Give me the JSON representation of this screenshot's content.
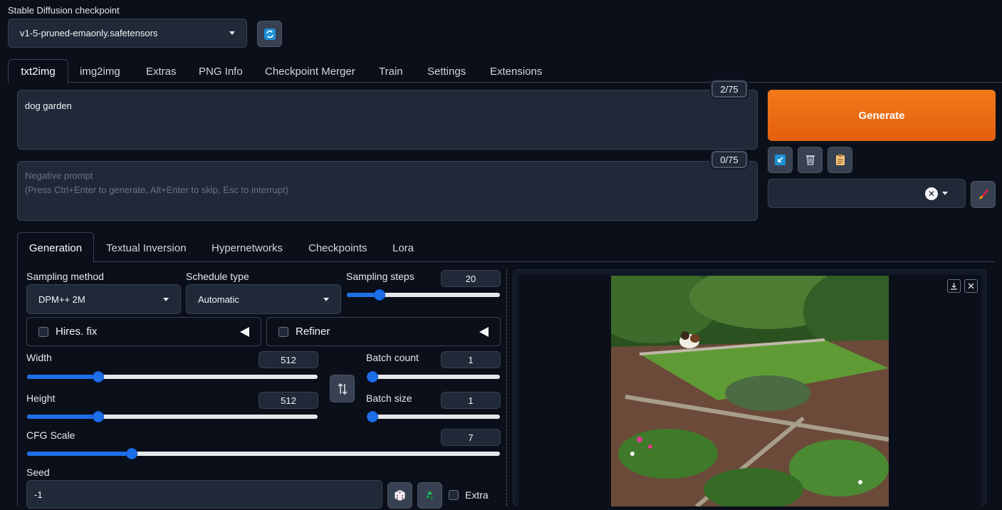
{
  "checkpoint": {
    "label": "Stable Diffusion checkpoint",
    "value": "v1-5-pruned-emaonly.safetensors"
  },
  "main_tabs": [
    "txt2img",
    "img2img",
    "Extras",
    "PNG Info",
    "Checkpoint Merger",
    "Train",
    "Settings",
    "Extensions"
  ],
  "prompt": {
    "value": "dog garden",
    "counter": "2/75"
  },
  "negative_prompt": {
    "placeholder_line1": "Negative prompt",
    "placeholder_line2": "(Press Ctrl+Enter to generate, Alt+Enter to skip, Esc to interrupt)",
    "counter": "0/75"
  },
  "generate_label": "Generate",
  "sub_tabs": [
    "Generation",
    "Textual Inversion",
    "Hypernetworks",
    "Checkpoints",
    "Lora"
  ],
  "sampling_method": {
    "label": "Sampling method",
    "value": "DPM++ 2M"
  },
  "schedule_type": {
    "label": "Schedule type",
    "value": "Automatic"
  },
  "sampling_steps": {
    "label": "Sampling steps",
    "value": "20",
    "fraction": 0.19
  },
  "hires_fix": {
    "label": "Hires. fix"
  },
  "refiner": {
    "label": "Refiner"
  },
  "width": {
    "label": "Width",
    "value": "512",
    "fraction": 0.235
  },
  "height": {
    "label": "Height",
    "value": "512",
    "fraction": 0.235
  },
  "batch_count": {
    "label": "Batch count",
    "value": "1",
    "fraction": 0.0
  },
  "batch_size": {
    "label": "Batch size",
    "value": "1",
    "fraction": 0.0
  },
  "cfg_scale": {
    "label": "CFG Scale",
    "value": "7",
    "fraction": 0.215
  },
  "seed": {
    "label": "Seed",
    "value": "-1",
    "extra_label": "Extra"
  },
  "colors": {
    "accent": "#1d6fe8",
    "generate": "#ea6a10",
    "background": "#0b0f19"
  }
}
